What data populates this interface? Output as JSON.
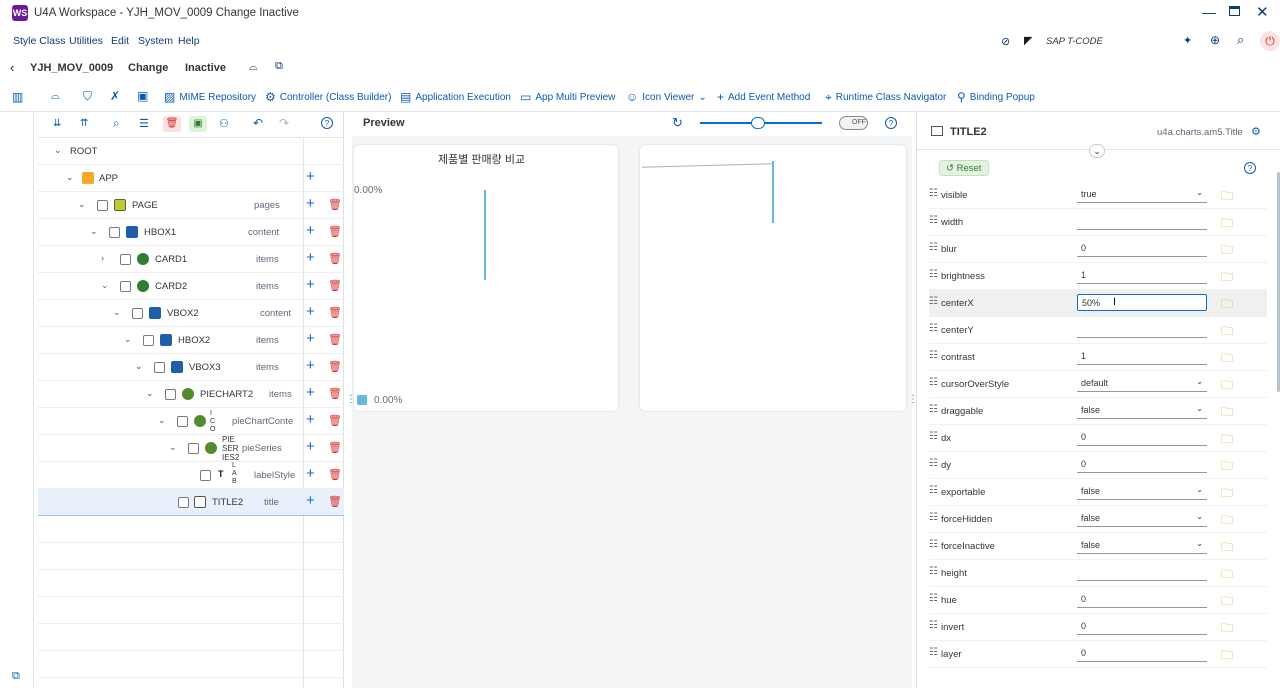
{
  "window": {
    "title": "U4A Workspace - YJH_MOV_0009 Change Inactive",
    "logo": "WS"
  },
  "menu": [
    "Style Class",
    "Utilities",
    "Edit",
    "System",
    "Help"
  ],
  "status_right": {
    "tcode_label": "SAP T-CODE"
  },
  "appbar": {
    "app_id": "YJH_MOV_0009",
    "mode": "Change",
    "state": "Inactive"
  },
  "toolbar": {
    "mime": "MIME Repository",
    "controller": "Controller (Class Builder)",
    "app_exec": "Application Execution",
    "multi_preview": "App Multi Preview",
    "icon_viewer": "Icon Viewer",
    "add_event": "Add Event Method",
    "runtime_nav": "Runtime Class Navigator",
    "binding_popup": "Binding Popup"
  },
  "tree": {
    "root": "ROOT",
    "nodes": [
      {
        "label": "APP",
        "agg": ""
      },
      {
        "label": "PAGE",
        "agg": "pages"
      },
      {
        "label": "HBOX1",
        "agg": "content"
      },
      {
        "label": "CARD1",
        "agg": "items"
      },
      {
        "label": "CARD2",
        "agg": "items"
      },
      {
        "label": "VBOX2",
        "agg": "content"
      },
      {
        "label": "HBOX2",
        "agg": "items"
      },
      {
        "label": "VBOX3",
        "agg": "items"
      },
      {
        "label": "PIECHART2",
        "agg": "items"
      },
      {
        "label": "I C O",
        "agg": "pieChartConte"
      },
      {
        "label": "PIE SER IES2",
        "agg": "pieSeries"
      },
      {
        "label": "L A B",
        "agg": "labelStyle"
      },
      {
        "label": "TITLE2",
        "agg": "title"
      }
    ]
  },
  "preview": {
    "title": "Preview",
    "toggle": "OFF",
    "chart_title": "제품별 판매량 비교",
    "pct_top": "0.00%",
    "pct_bottom": "0.00%"
  },
  "props": {
    "title": "TITLE2",
    "class": "u4a.charts.am5.Title",
    "reset": "Reset",
    "rows": [
      {
        "name": "visible",
        "value": "true",
        "type": "select"
      },
      {
        "name": "width",
        "value": "",
        "type": "input"
      },
      {
        "name": "blur",
        "value": "0",
        "type": "input"
      },
      {
        "name": "brightness",
        "value": "1",
        "type": "input"
      },
      {
        "name": "centerX",
        "value": "50%",
        "type": "input"
      },
      {
        "name": "centerY",
        "value": "",
        "type": "input"
      },
      {
        "name": "contrast",
        "value": "1",
        "type": "input"
      },
      {
        "name": "cursorOverStyle",
        "value": "default",
        "type": "select"
      },
      {
        "name": "draggable",
        "value": "false",
        "type": "select"
      },
      {
        "name": "dx",
        "value": "0",
        "type": "input"
      },
      {
        "name": "dy",
        "value": "0",
        "type": "input"
      },
      {
        "name": "exportable",
        "value": "false",
        "type": "select"
      },
      {
        "name": "forceHidden",
        "value": "false",
        "type": "select"
      },
      {
        "name": "forceInactive",
        "value": "false",
        "type": "select"
      },
      {
        "name": "height",
        "value": "",
        "type": "input"
      },
      {
        "name": "hue",
        "value": "0",
        "type": "input"
      },
      {
        "name": "invert",
        "value": "0",
        "type": "input"
      },
      {
        "name": "layer",
        "value": "0",
        "type": "input"
      }
    ]
  },
  "colors": {
    "accent": "#0a6ed1",
    "delete": "#d32f2f",
    "folder": "#e0a800"
  }
}
